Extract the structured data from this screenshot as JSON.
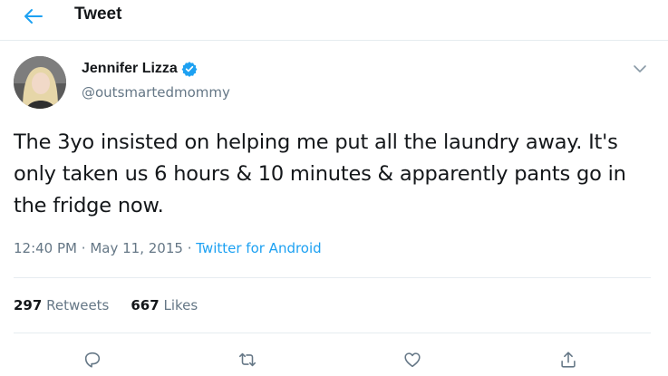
{
  "header": {
    "title": "Tweet",
    "back_icon": "arrow-left-icon"
  },
  "accent_color": "#1da1f2",
  "author": {
    "display_name": "Jennifer Lizza",
    "handle": "@outsmartedmommy",
    "verified_icon": "verified-badge-icon"
  },
  "tweet": {
    "text": "The 3yo insisted on helping me put all the laundry away. It's only taken us 6 hours & 10 minutes & apparently pants go in the fridge now.",
    "time": "12:40 PM",
    "date": "May 11, 2015",
    "separator": "·",
    "source": "Twitter for Android"
  },
  "stats": {
    "retweets_count": "297",
    "retweets_label": "Retweets",
    "likes_count": "667",
    "likes_label": "Likes"
  },
  "actions": [
    "reply-icon",
    "retweet-icon",
    "like-icon",
    "share-icon"
  ]
}
